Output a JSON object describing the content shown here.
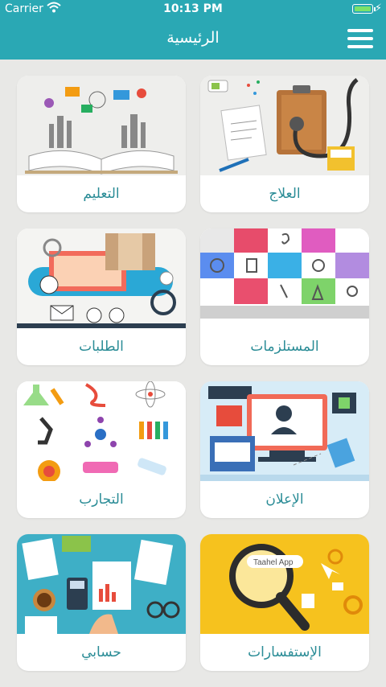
{
  "status_bar": {
    "carrier": "Carrier",
    "time": "10:13 PM"
  },
  "header": {
    "title": "الرئيسية",
    "menu_icon": "hamburger-menu-icon"
  },
  "cards": [
    {
      "label": "العلاج",
      "icon": "clipboard-stethoscope-icon"
    },
    {
      "label": "التعليم",
      "icon": "open-book-icon"
    },
    {
      "label": "المستلزمات",
      "icon": "medical-supplies-grid-icon"
    },
    {
      "label": "الطلبات",
      "icon": "orders-process-icon"
    },
    {
      "label": "الإعلان",
      "icon": "advertising-screens-icon"
    },
    {
      "label": "التجارب",
      "icon": "lab-experiments-icon"
    },
    {
      "label": "الإستفسارات",
      "icon": "magnifier-inquiries-icon",
      "image_text": "Taahel App"
    },
    {
      "label": "حسابي",
      "icon": "account-documents-icon"
    }
  ],
  "colors": {
    "header": "#2aa8b4",
    "label": "#2a8c96",
    "background": "#e8e8e6"
  }
}
